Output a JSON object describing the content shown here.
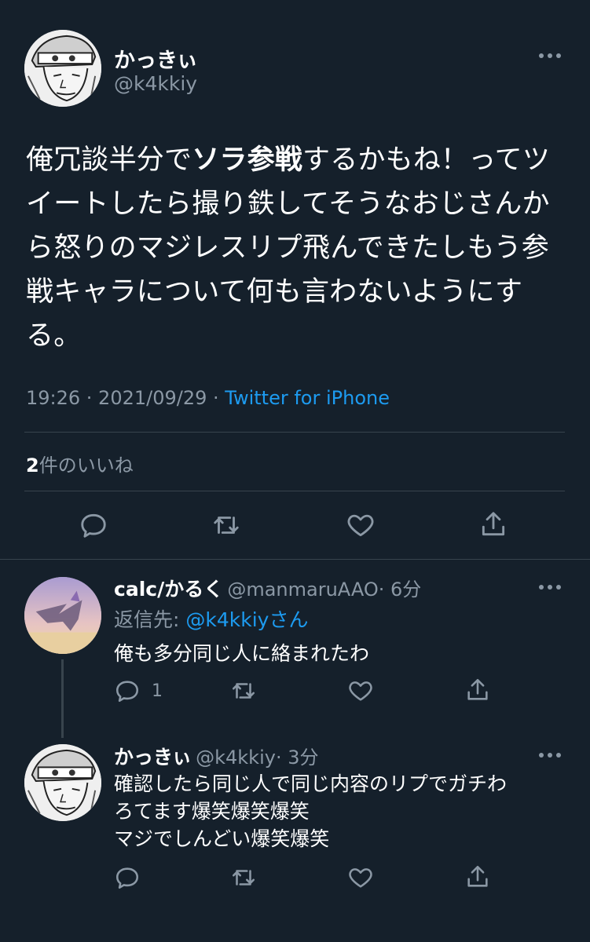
{
  "main_tweet": {
    "author_name": "かっきぃ",
    "author_handle": "@k4kkiy",
    "text_before": "俺冗談半分で",
    "text_bold": "ソラ参戦",
    "text_after": "するかもね！ってツイートしたら撮り鉄してそうなおじさんから怒りのマジレスリプ飛んできたしもう参戦キャラについて何も言わないようにする。",
    "timestamp": "19:26 · 2021/09/29 · ",
    "source": "Twitter for iPhone",
    "likes_count": "2",
    "likes_label": "件のいいね"
  },
  "replies": [
    {
      "author_name": "calc/かるく",
      "author_handle": "@manmaruAAO",
      "time": "· 6分",
      "reply_to_label": "返信先: ",
      "reply_to_handle": "@k4kkiyさん",
      "text": "俺も多分同じ人に絡まれたわ",
      "reply_count": "1"
    },
    {
      "author_name": "かっきぃ",
      "author_handle": "@k4kkiy",
      "time": "· 3分",
      "text_line1": "確認したら同じ人で同じ内容のリプでガチわ",
      "text_line2": "ろてます爆笑爆笑爆笑",
      "text_line3": "マジでしんどい爆笑爆笑"
    }
  ],
  "colors": {
    "background": "#15202b",
    "text": "#ffffff",
    "muted": "#8b98a5",
    "link": "#1d9bf0",
    "divider": "#38444d"
  },
  "icons": [
    "more-icon",
    "reply-icon",
    "retweet-icon",
    "like-icon",
    "share-icon"
  ]
}
